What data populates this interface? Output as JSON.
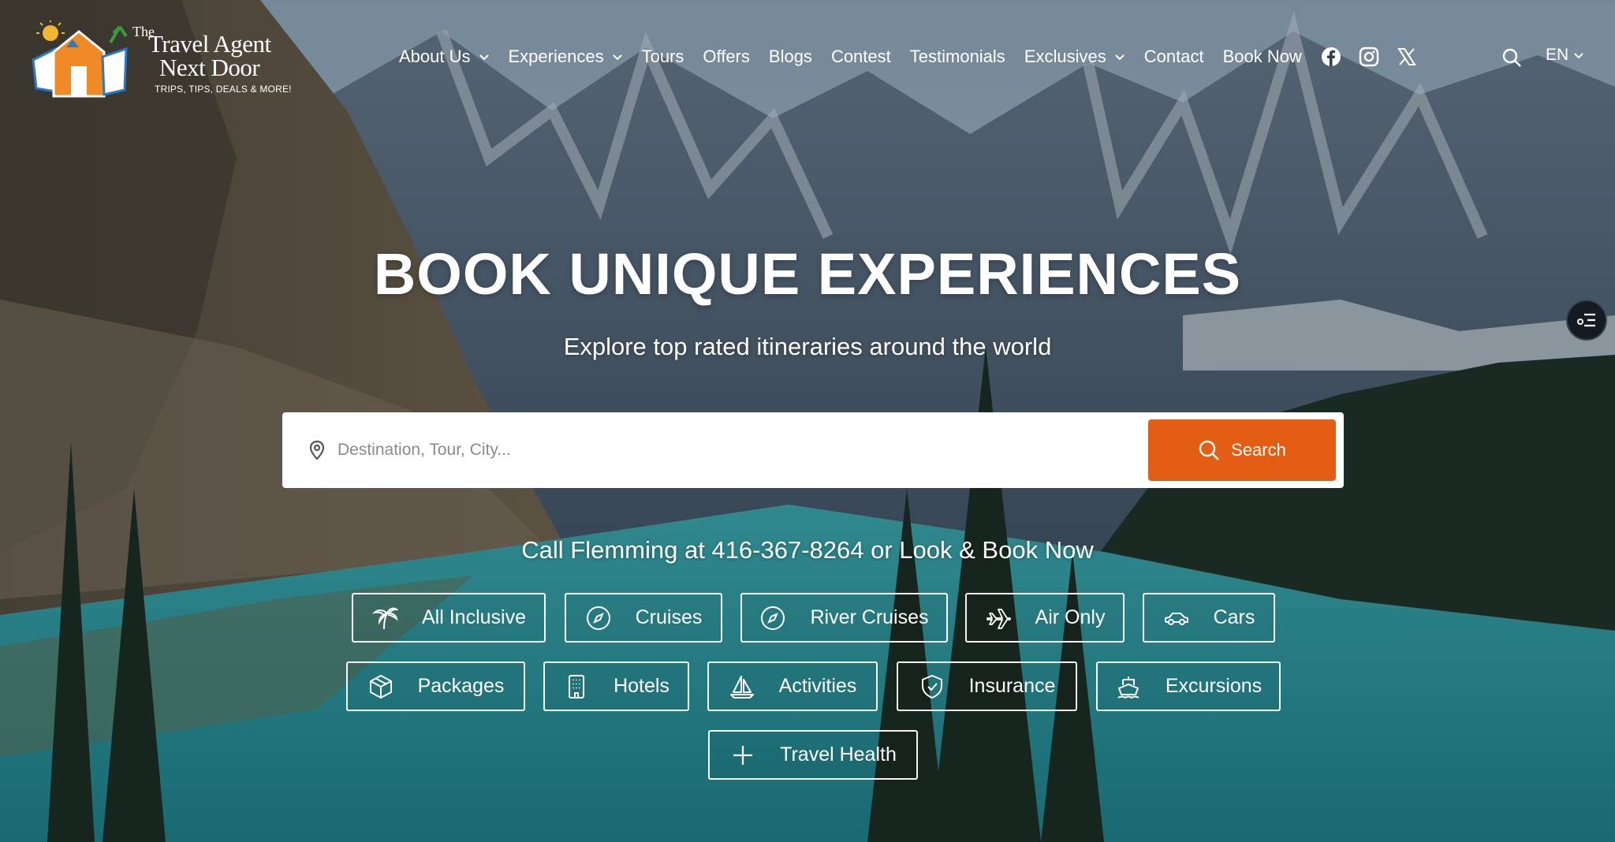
{
  "logo": {
    "the": "The",
    "line1": "Travel Agent",
    "line2": "Next Door",
    "tagline": "TRIPS, TIPS, DEALS & MORE!"
  },
  "nav": {
    "items": [
      {
        "label": "About Us",
        "dropdown": true
      },
      {
        "label": "Experiences",
        "dropdown": true
      },
      {
        "label": "Tours",
        "dropdown": false
      },
      {
        "label": "Offers",
        "dropdown": false
      },
      {
        "label": "Blogs",
        "dropdown": false
      },
      {
        "label": "Contest",
        "dropdown": false
      },
      {
        "label": "Testimonials",
        "dropdown": false
      },
      {
        "label": "Exclusives",
        "dropdown": true
      },
      {
        "label": "Contact",
        "dropdown": false
      },
      {
        "label": "Book Now",
        "dropdown": false
      }
    ],
    "social_icons": [
      "facebook-icon",
      "instagram-icon",
      "x-icon"
    ],
    "language": "EN"
  },
  "hero": {
    "title": "BOOK UNIQUE EXPERIENCES",
    "subtitle": "Explore top rated itineraries around the world"
  },
  "search": {
    "placeholder": "Destination, Tour, City...",
    "value": "",
    "button_label": "Search"
  },
  "call_text": "Call Flemming at 416-367-8264 or Look & Book Now",
  "categories": [
    {
      "label": "All Inclusive",
      "icon": "palm-tree-icon"
    },
    {
      "label": "Cruises",
      "icon": "compass-icon"
    },
    {
      "label": "River Cruises",
      "icon": "compass-icon"
    },
    {
      "label": "Air Only",
      "icon": "plane-icon"
    },
    {
      "label": "Cars",
      "icon": "car-icon"
    },
    {
      "label": "Packages",
      "icon": "package-icon"
    },
    {
      "label": "Hotels",
      "icon": "building-icon"
    },
    {
      "label": "Activities",
      "icon": "sailboat-icon"
    },
    {
      "label": "Insurance",
      "icon": "shield-check-icon"
    },
    {
      "label": "Excursions",
      "icon": "ship-icon"
    },
    {
      "label": "Travel Health",
      "icon": "plus-icon"
    }
  ],
  "colors": {
    "accent": "#e35d14",
    "water": "#2aa0a8",
    "text": "#ffffff"
  }
}
